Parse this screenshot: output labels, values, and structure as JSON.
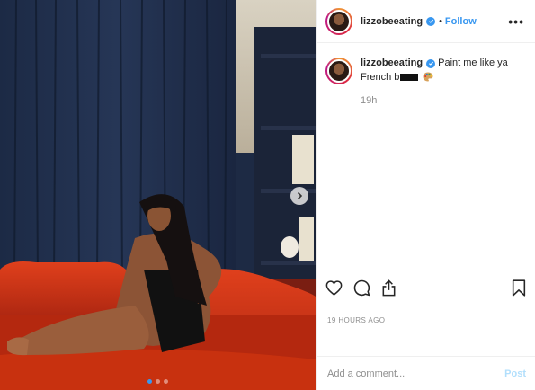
{
  "post": {
    "photo": {
      "carousel_count": 3,
      "carousel_active": 0,
      "next_icon": "chevron-right-icon"
    },
    "header": {
      "username": "lizzobeeating",
      "separator": "•",
      "follow_label": "Follow",
      "more_label": "•••"
    },
    "caption": {
      "username": "lizzobeeating",
      "text_part1": "Paint me like ya French b",
      "censored": true,
      "emoji": "artist-palette-icon",
      "time_ago": "19h"
    },
    "actions": {
      "icons": [
        "heart-icon",
        "comment-icon",
        "share-icon",
        "bookmark-icon"
      ]
    },
    "posted_ago": "19 HOURS AGO",
    "comment_box": {
      "placeholder": "Add a comment...",
      "post_label": "Post"
    },
    "colors": {
      "link_blue": "#3897f0",
      "post_disabled": "#b2dffc",
      "muted": "#8e8e8e",
      "verified_badge": "#3897f0"
    }
  }
}
